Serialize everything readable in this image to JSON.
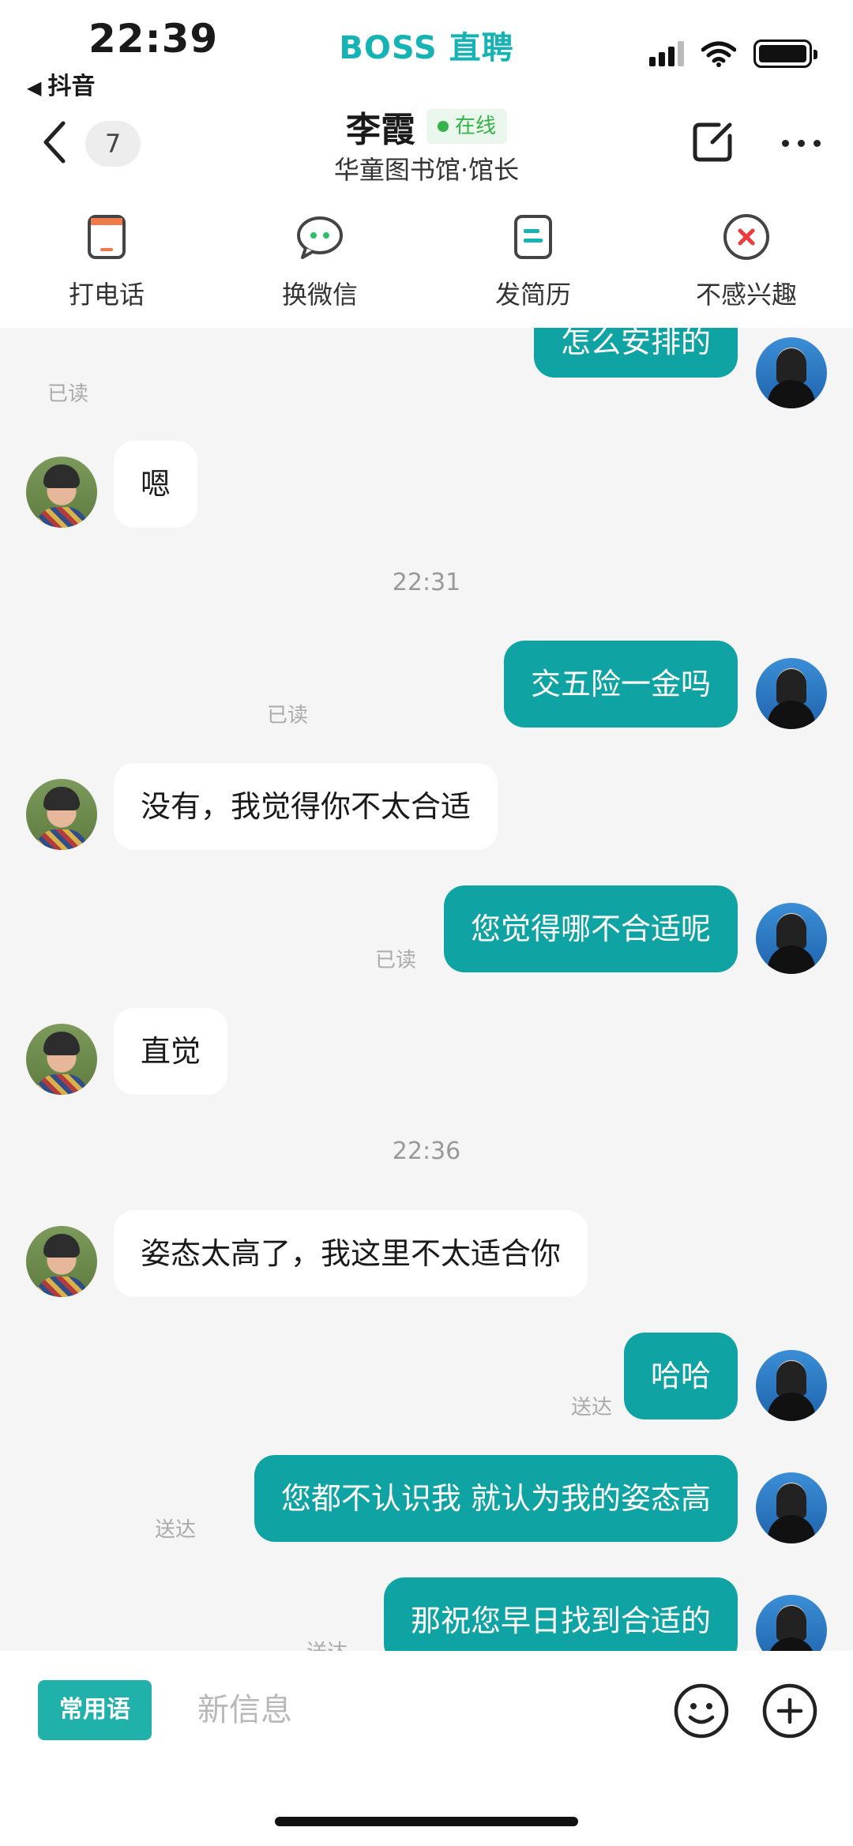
{
  "status_bar": {
    "time": "22:39",
    "back_app": "抖音",
    "brand": "BOSS 直聘"
  },
  "header": {
    "unread_count": "7",
    "contact_name": "李霞",
    "online_label": "在线",
    "subtitle": "华童图书馆·馆长"
  },
  "actions": [
    {
      "label": "打电话",
      "icon": "phone-icon"
    },
    {
      "label": "换微信",
      "icon": "wechat-icon"
    },
    {
      "label": "发简历",
      "icon": "resume-icon"
    },
    {
      "label": "不感兴趣",
      "icon": "not-interested-icon"
    }
  ],
  "messages": [
    {
      "from": "me",
      "text": "怎么安排的",
      "status": "已读"
    },
    {
      "from": "them",
      "text": "嗯"
    },
    {
      "time": "22:31"
    },
    {
      "from": "me",
      "text": "交五险一金吗",
      "status": "已读"
    },
    {
      "from": "them",
      "text": "没有，我觉得你不太合适"
    },
    {
      "from": "me",
      "text": "您觉得哪不合适呢",
      "status": "已读"
    },
    {
      "from": "them",
      "text": "直觉"
    },
    {
      "time": "22:36"
    },
    {
      "from": "them",
      "text": "姿态太高了，我这里不太适合你"
    },
    {
      "from": "me",
      "text": "哈哈",
      "status": "送达"
    },
    {
      "from": "me",
      "text": "您都不认识我  就认为我的姿态高",
      "status": "送达"
    },
    {
      "from": "me",
      "text": "那祝您早日找到合适的",
      "status": "送达"
    }
  ],
  "input_bar": {
    "phrases_label": "常用语",
    "placeholder": "新信息"
  },
  "colors": {
    "brand": "#15b3b3",
    "my_bubble": "#10a3a3",
    "online": "#36b24a",
    "phrases_button": "#20b2aa"
  }
}
